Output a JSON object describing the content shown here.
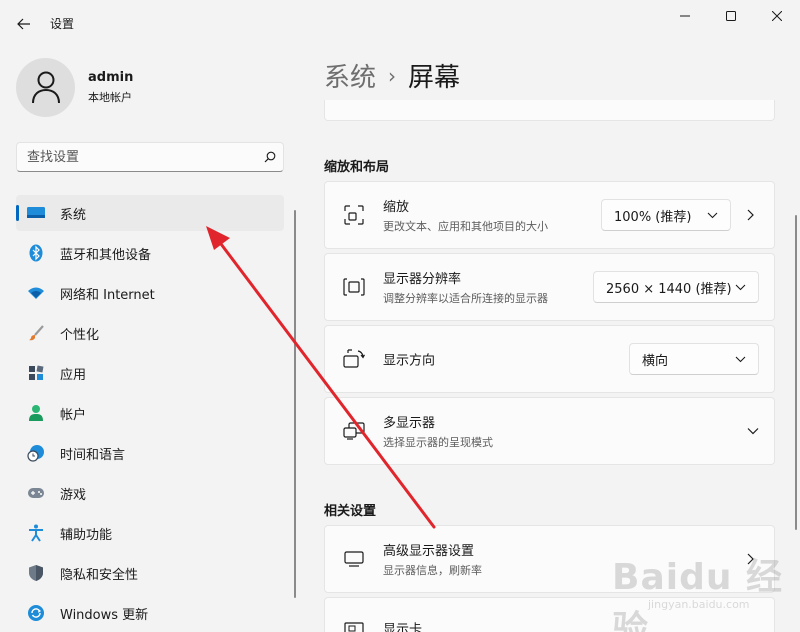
{
  "window": {
    "title": "设置",
    "controls": {
      "minimize": "minimize-icon",
      "maximize": "maximize-icon",
      "close": "close-icon"
    }
  },
  "profile": {
    "name": "admin",
    "account_type": "本地帐户"
  },
  "search": {
    "placeholder": "查找设置"
  },
  "sidebar": {
    "items": [
      {
        "label": "系统",
        "icon": "system-display-icon",
        "active": true
      },
      {
        "label": "蓝牙和其他设备",
        "icon": "bluetooth-icon"
      },
      {
        "label": "网络和 Internet",
        "icon": "wifi-icon"
      },
      {
        "label": "个性化",
        "icon": "paintbrush-icon"
      },
      {
        "label": "应用",
        "icon": "apps-icon"
      },
      {
        "label": "帐户",
        "icon": "account-icon"
      },
      {
        "label": "时间和语言",
        "icon": "globe-clock-icon"
      },
      {
        "label": "游戏",
        "icon": "gamepad-icon"
      },
      {
        "label": "辅助功能",
        "icon": "accessibility-icon"
      },
      {
        "label": "隐私和安全性",
        "icon": "shield-icon"
      },
      {
        "label": "Windows 更新",
        "icon": "update-icon"
      }
    ]
  },
  "breadcrumb": {
    "parent": "系统",
    "separator": "›",
    "current": "屏幕"
  },
  "scale_layout": {
    "heading": "缩放和布局",
    "rows": [
      {
        "title": "缩放",
        "subtitle": "更改文本、应用和其他项目的大小",
        "value": "100% (推荐)",
        "icon": "scale-icon"
      },
      {
        "title": "显示器分辨率",
        "subtitle": "调整分辨率以适合所连接的显示器",
        "value": "2560 × 1440 (推荐)",
        "icon": "resolution-icon"
      },
      {
        "title": "显示方向",
        "subtitle": "",
        "value": "横向",
        "icon": "orientation-icon"
      },
      {
        "title": "多显示器",
        "subtitle": "选择显示器的呈现模式",
        "value": "",
        "icon": "multi-monitor-icon"
      }
    ]
  },
  "related": {
    "heading": "相关设置",
    "rows": [
      {
        "title": "高级显示器设置",
        "subtitle": "显示器信息，刷新率",
        "icon": "monitor-icon"
      },
      {
        "title": "显示卡",
        "subtitle": "",
        "icon": "graphics-card-icon"
      }
    ]
  },
  "colors": {
    "accent": "#0067c0",
    "annotation_arrow": "#e0262c",
    "background": "#f3f3f3",
    "card": "#fbfbfb"
  },
  "watermark": {
    "main": "Baidu 经验",
    "sub": "jingyan.baidu.com"
  }
}
